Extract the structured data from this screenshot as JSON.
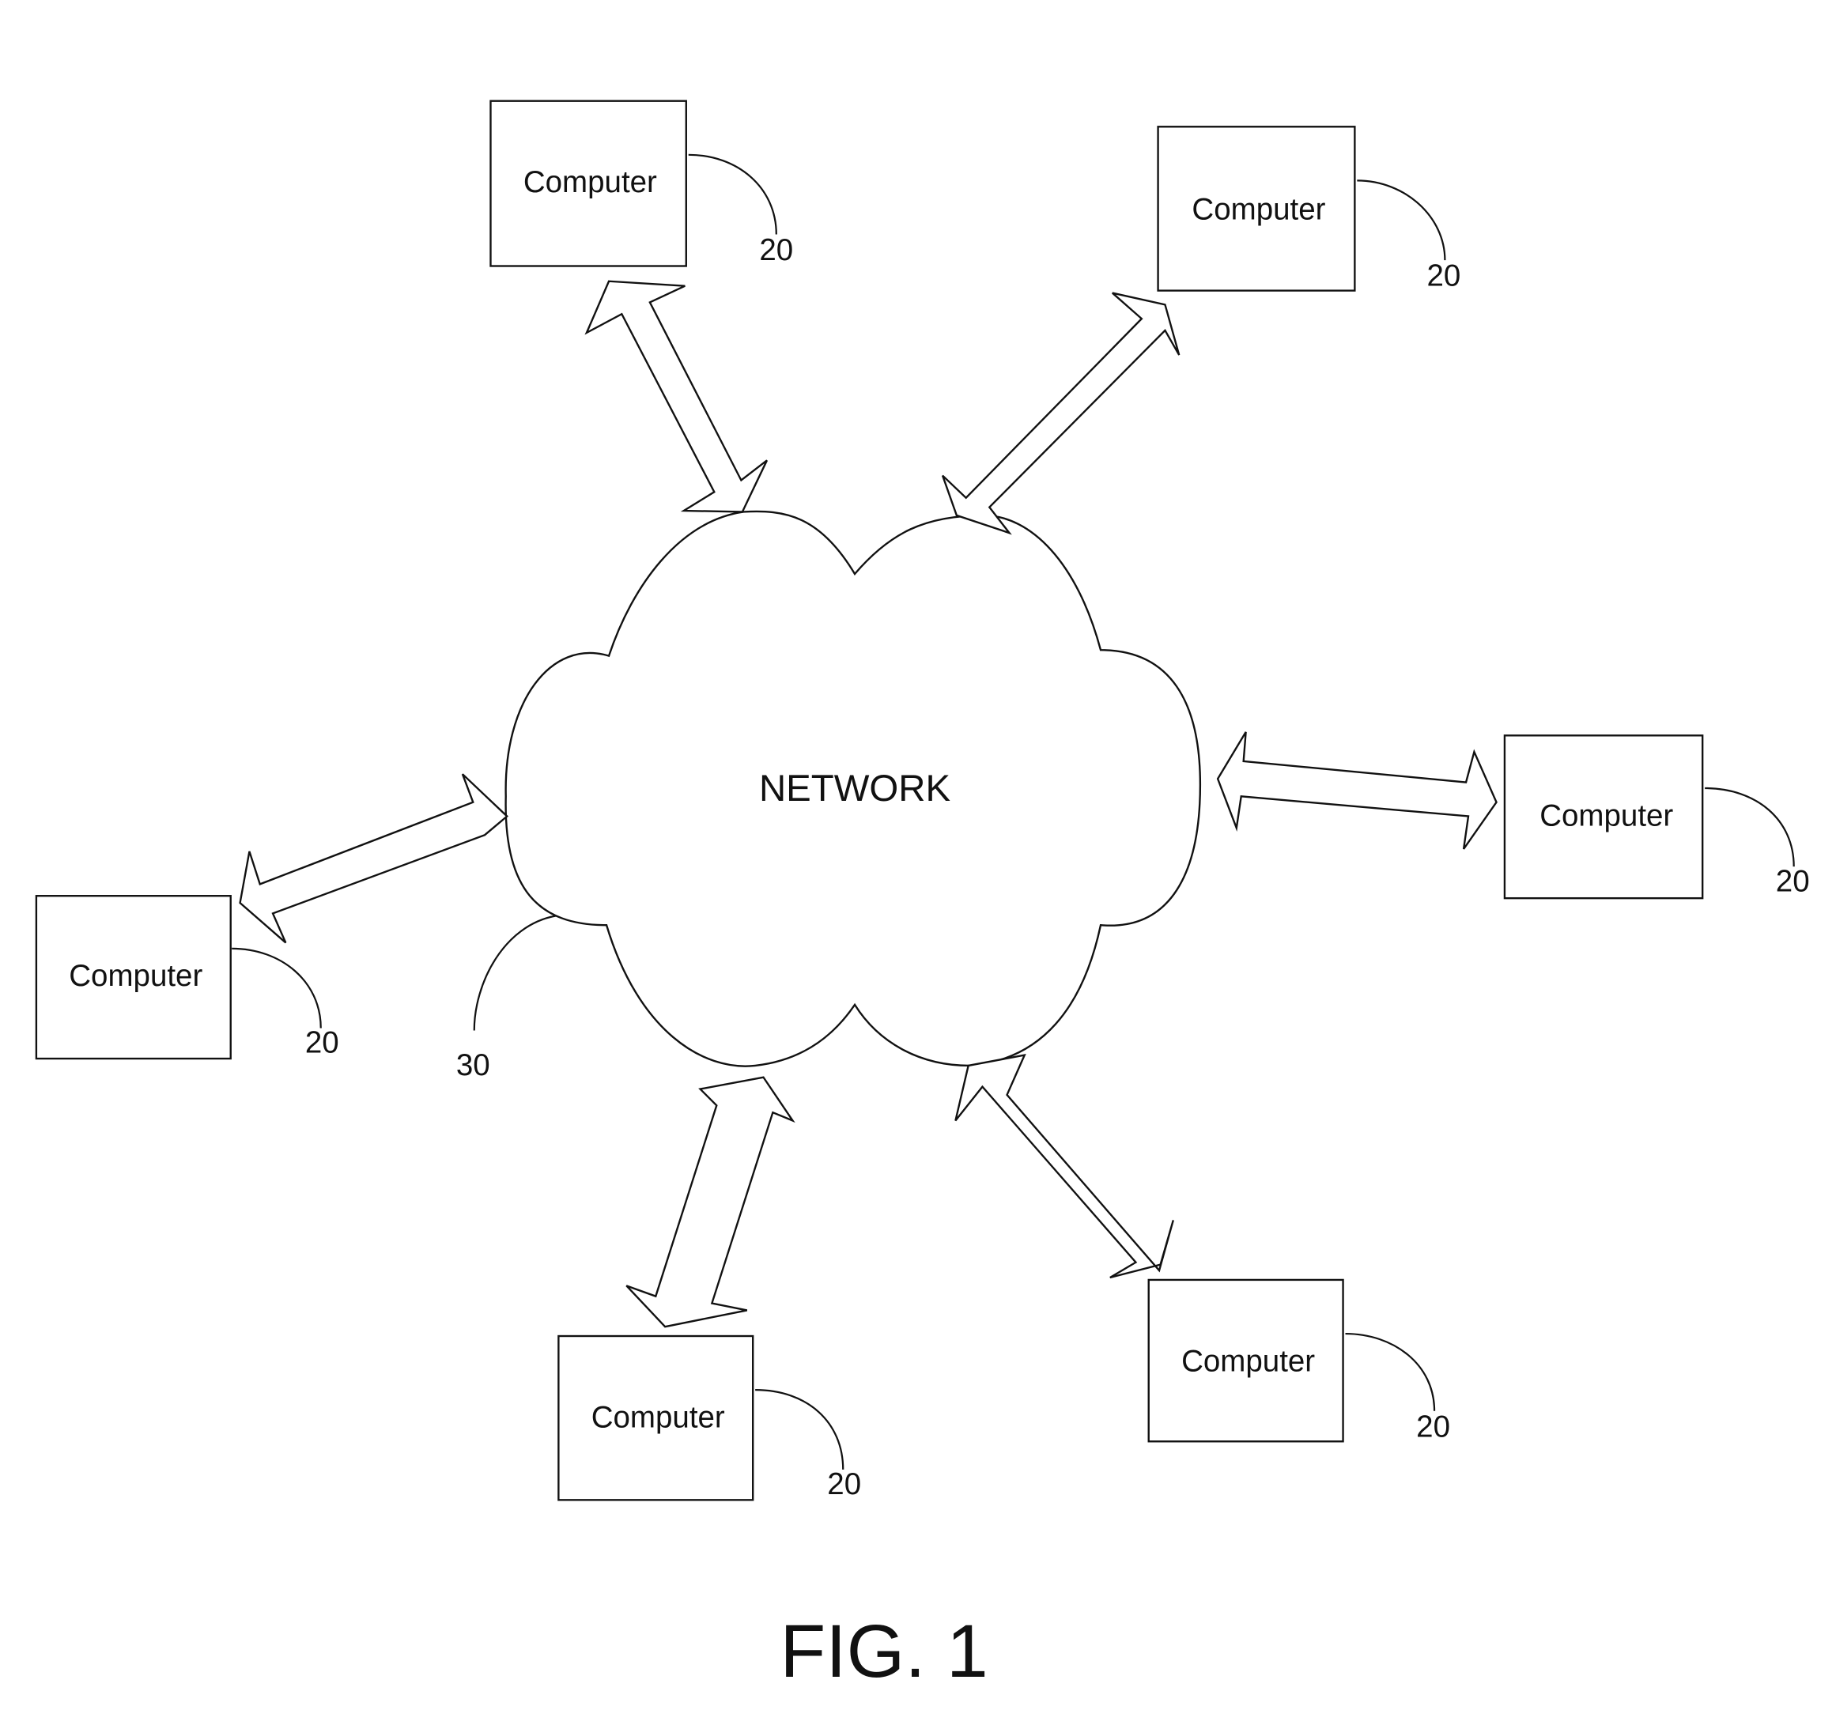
{
  "figure": {
    "caption": "FIG. 1",
    "network": {
      "label": "NETWORK",
      "ref": "30"
    },
    "computers": [
      {
        "id": "top-left",
        "label": "Computer",
        "ref": "20"
      },
      {
        "id": "top-right",
        "label": "Computer",
        "ref": "20"
      },
      {
        "id": "right",
        "label": "Computer",
        "ref": "20"
      },
      {
        "id": "left",
        "label": "Computer",
        "ref": "20"
      },
      {
        "id": "bottom-left",
        "label": "Computer",
        "ref": "20"
      },
      {
        "id": "bottom-right",
        "label": "Computer",
        "ref": "20"
      }
    ],
    "connections": [
      {
        "from": "network",
        "to": "top-left",
        "type": "bidirectional"
      },
      {
        "from": "network",
        "to": "top-right",
        "type": "bidirectional"
      },
      {
        "from": "network",
        "to": "right",
        "type": "bidirectional"
      },
      {
        "from": "network",
        "to": "left",
        "type": "bidirectional"
      },
      {
        "from": "network",
        "to": "bottom-left",
        "type": "bidirectional"
      },
      {
        "from": "network",
        "to": "bottom-right",
        "type": "bidirectional"
      }
    ]
  }
}
